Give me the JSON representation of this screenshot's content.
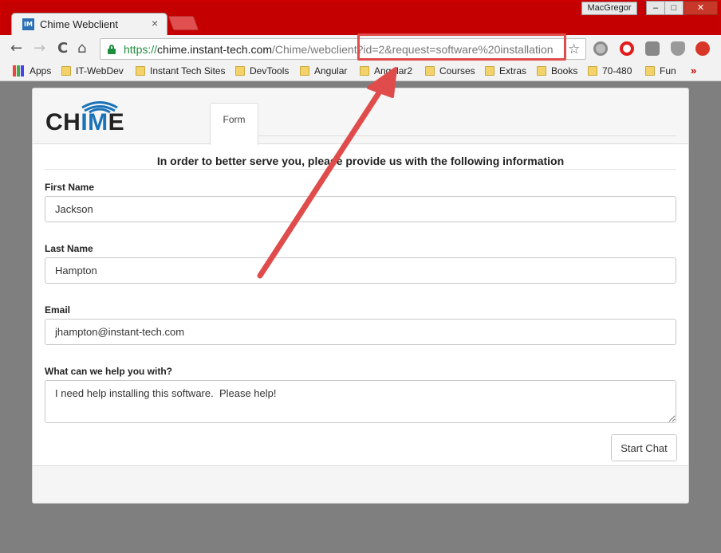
{
  "browser": {
    "tab_title": "Chime Webclient",
    "tab_close": "×",
    "profile_name": "MacGregor",
    "window_controls": {
      "minimize": "–",
      "maximize": "□",
      "close": "✕"
    },
    "nav": {
      "back": "←",
      "forward": "→",
      "reload": "C",
      "home": "⌂"
    },
    "url": {
      "scheme": "https://",
      "host": "chime.instant-tech.com",
      "path": "/Chime/webclient",
      "query": "?id=2&request=software%20installation"
    },
    "star": "☆",
    "extensions": [
      "bug-icon",
      "opera-icon",
      "user-icon",
      "shield-icon",
      "upload-icon"
    ]
  },
  "bookmarks": {
    "apps_label": "Apps",
    "items": [
      "IT-WebDev",
      "Instant Tech Sites",
      "DevTools",
      "Angular",
      "Angular2",
      "Courses",
      "Extras",
      "Books",
      "70-480",
      "Fun"
    ],
    "more": "»"
  },
  "page": {
    "logo": {
      "prefix": "CH",
      "accent": "IM",
      "suffix": "E"
    },
    "tab_form": "Form",
    "intro": "In order to better serve you, please provide us with the following information",
    "first_name": {
      "label": "First Name",
      "value": "Jackson"
    },
    "last_name": {
      "label": "Last Name",
      "value": "Hampton"
    },
    "email": {
      "label": "Email",
      "value": "jhampton@instant-tech.com"
    },
    "help": {
      "label": "What can we help you with?",
      "value": "I need help installing this software.  Please help!"
    },
    "start_chat": "Start Chat"
  },
  "colors": {
    "accent_blue": "#1a73b8",
    "annotation_red": "#e04b4b",
    "chrome_red": "#c40000"
  }
}
